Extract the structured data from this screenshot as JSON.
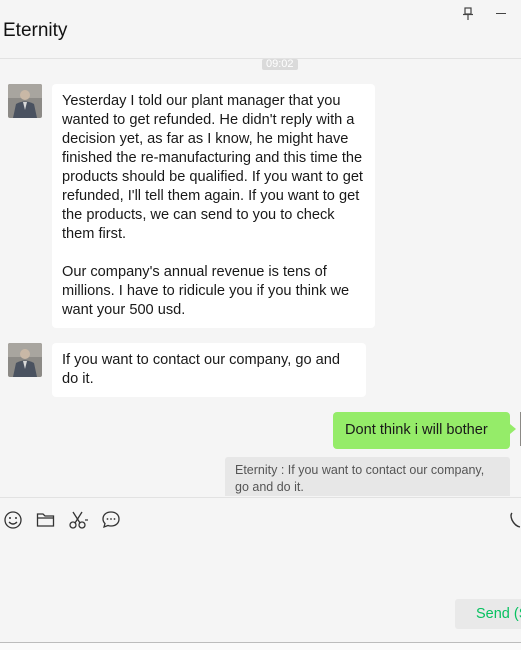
{
  "window": {
    "title": "Eternity"
  },
  "chat": {
    "timestamp": "09:02",
    "messages": [
      {
        "paragraphs": [
          "Yesterday I told our plant manager that you wanted to get refunded. He didn't reply with a decision yet, as far as I know, he might have finished the re-manufacturing and this time the products should be qualified. If you want to get refunded, I'll tell them again. If you want to get the products, we can send to you to check them first.",
          "Our company's annual revenue is tens of millions. I have to ridicule you if you think we want your 500 usd."
        ]
      },
      {
        "paragraphs": [
          "If you want to contact our company, go and do it."
        ]
      }
    ],
    "reply": {
      "text": "Dont think i will bother",
      "quote": "Eternity : If you want to contact our company, go and do it."
    }
  },
  "toolbar": {
    "icons": [
      "emoji-icon",
      "folder-icon",
      "scissors-icon",
      "chat-history-icon",
      "phone-icon"
    ],
    "send_label": "Send (S)"
  },
  "colors": {
    "accent_green": "#07c160",
    "outgoing_bubble": "#95ec69",
    "incoming_bubble": "#ffffff",
    "background": "#f5f5f5"
  }
}
